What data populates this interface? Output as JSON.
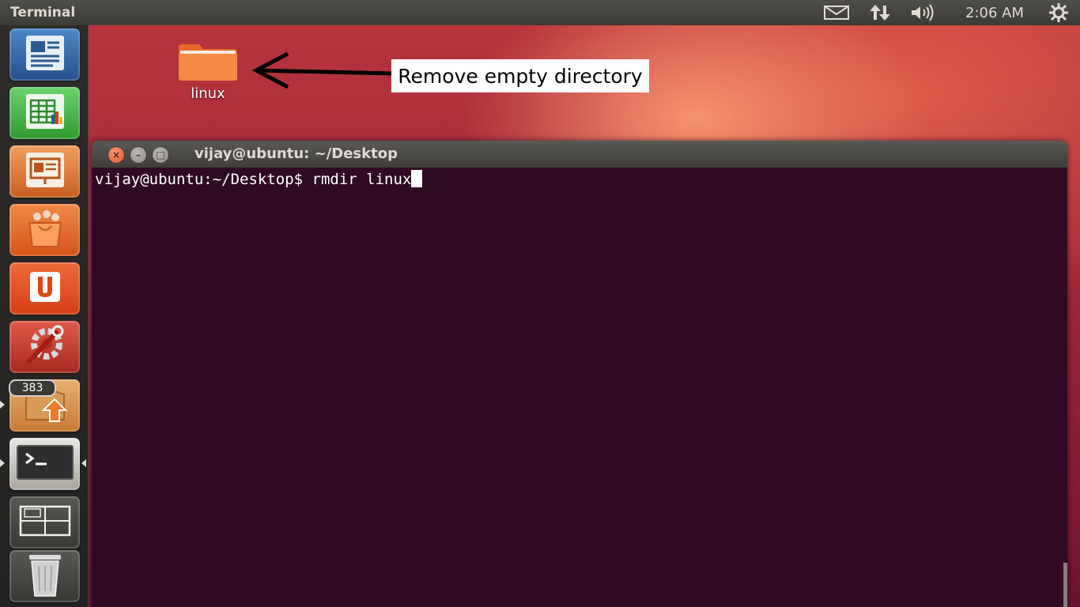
{
  "top_panel": {
    "app_title": "Terminal",
    "clock": "2:06 AM",
    "indicators": [
      "mail-icon",
      "network-updown-icon",
      "volume-icon",
      "session-gear-icon"
    ]
  },
  "launcher": {
    "items": [
      {
        "name": "LibreOffice Writer",
        "icon": "writer-document-icon"
      },
      {
        "name": "LibreOffice Calc",
        "icon": "calc-spreadsheet-icon"
      },
      {
        "name": "LibreOffice Impress",
        "icon": "impress-presentation-icon"
      },
      {
        "name": "Ubuntu Software Center",
        "icon": "shopping-bag-icon"
      },
      {
        "name": "Ubuntu One",
        "icon": "ubuntu-one-icon"
      },
      {
        "name": "System Settings",
        "icon": "settings-wrench-gear-icon"
      },
      {
        "name": "Update Manager",
        "icon": "update-box-arrow-icon",
        "badge": "383"
      },
      {
        "name": "Terminal",
        "icon": "terminal-prompt-icon",
        "active": true
      },
      {
        "name": "Workspace Switcher",
        "icon": "workspaces-icon"
      },
      {
        "name": "Trash",
        "icon": "trash-icon"
      }
    ]
  },
  "desktop": {
    "folder_label": "linux",
    "annotation_text": "Remove empty directory"
  },
  "terminal": {
    "window_title": "vijay@ubuntu: ~/Desktop",
    "prompt": "vijay@ubuntu:~/Desktop$ ",
    "command": "rmdir linux"
  },
  "colors": {
    "terminal_bg": "#300a24",
    "panel_bg": "#3c3b37",
    "folder_orange": "#f07a3a"
  }
}
